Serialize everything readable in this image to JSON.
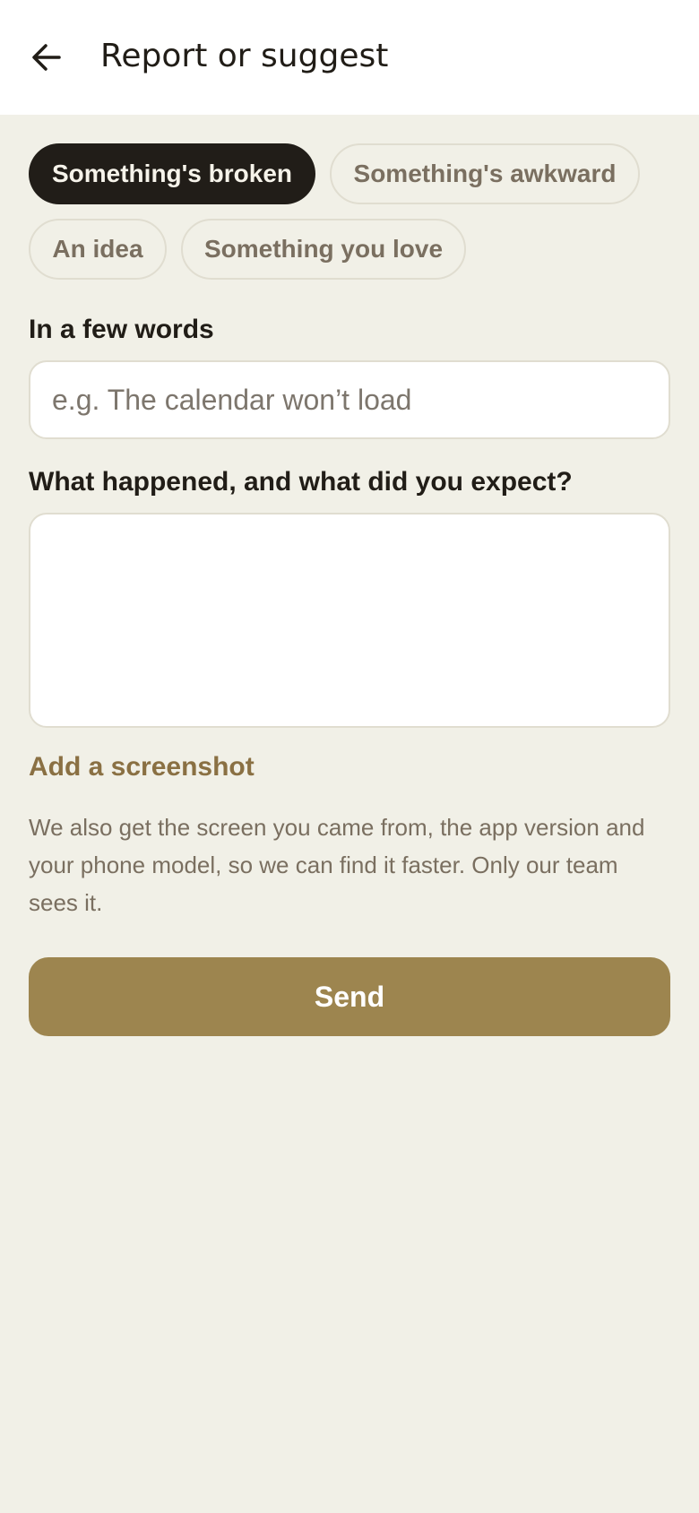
{
  "header": {
    "back_icon": "arrow-back-icon",
    "title": "Report or suggest"
  },
  "categories": [
    {
      "label": "Something's broken",
      "selected": true
    },
    {
      "label": "Something's awkward",
      "selected": false
    },
    {
      "label": "An idea",
      "selected": false
    },
    {
      "label": "Something you love",
      "selected": false
    }
  ],
  "summary": {
    "label": "In a few words",
    "value": "",
    "placeholder": "e.g. The calendar won’t load"
  },
  "details": {
    "label": "What happened, and what did you expect?",
    "value": ""
  },
  "add_screenshot_label": "Add a screenshot",
  "note": "We also get the screen you came from, the app version and your phone model, so we can find it faster. Only our team sees it.",
  "send_label": "Send",
  "colors": {
    "background": "#f1f0e7",
    "selected_chip": "#211d18",
    "accent": "#9d854f",
    "link": "#8a7043"
  }
}
